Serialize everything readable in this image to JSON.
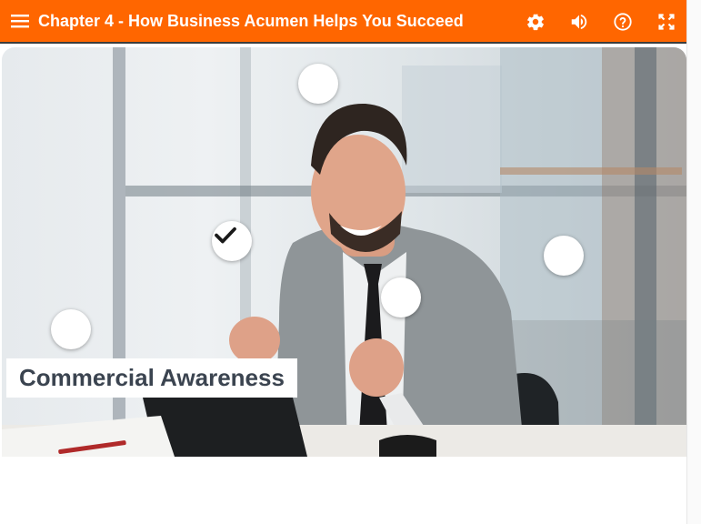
{
  "header": {
    "title": "Chapter 4 - How Business Acumen Helps You Succeed",
    "menu_icon": "hamburger-menu-icon",
    "tools": [
      "settings-gear-icon",
      "volume-icon",
      "help-icon",
      "fullscreen-icon"
    ]
  },
  "colors": {
    "header_bg": "#ff6600",
    "label_text": "#3b4450"
  },
  "scene": {
    "image_description_icon": "man-celebrating-at-laptop",
    "caption": "Commercial Awareness",
    "hotspots": [
      {
        "id": "top-center",
        "visited": false
      },
      {
        "id": "left-middle",
        "visited": true
      },
      {
        "id": "right-middle",
        "visited": false
      },
      {
        "id": "center",
        "visited": false
      },
      {
        "id": "left-lower",
        "visited": false
      }
    ]
  }
}
